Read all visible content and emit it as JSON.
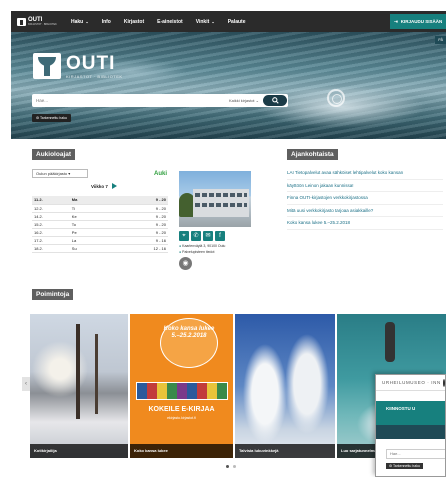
{
  "topbar": {
    "brand_name": "OUTI",
    "brand_sub": "KIRJASTOT · BIBLIOTEK",
    "nav": [
      {
        "label": "Haku",
        "has_dropdown": true
      },
      {
        "label": "Info",
        "has_dropdown": false
      },
      {
        "label": "Kirjastot",
        "has_dropdown": false
      },
      {
        "label": "E-aineistot",
        "has_dropdown": false
      },
      {
        "label": "Vinkit",
        "has_dropdown": true
      },
      {
        "label": "Palaute",
        "has_dropdown": false
      }
    ],
    "login_label": "KIRJAUDU SISÄÄN"
  },
  "hero": {
    "title": "OUTI",
    "subtitle": "KIRJASTOT · BIBLIOTEK",
    "lang_tag": "PÅ",
    "search_placeholder": "Hae...",
    "search_scope": "Kaikki kirjastot",
    "advanced_search": "Tarkennettu haku"
  },
  "hours": {
    "title": "Aukioloajat",
    "branch_select": "Oulun pääkirjasto",
    "status": "Auki",
    "week_label": "Viikko 7",
    "rows": [
      {
        "date": "11.2.",
        "day": "Ma",
        "time": "9 - 20",
        "today": true
      },
      {
        "date": "12.2.",
        "day": "Ti",
        "time": "9 - 20",
        "today": false
      },
      {
        "date": "14.2.",
        "day": "Ke",
        "time": "9 - 20",
        "today": false
      },
      {
        "date": "15.2.",
        "day": "To",
        "time": "9 - 20",
        "today": false
      },
      {
        "date": "16.2.",
        "day": "Pe",
        "time": "9 - 20",
        "today": false
      },
      {
        "date": "17.2.",
        "day": "La",
        "time": "9 - 16",
        "today": false
      },
      {
        "date": "18.2.",
        "day": "Su",
        "time": "12 - 16",
        "today": false
      }
    ],
    "address": "Kaarlenväylä 3, 90100 Oulu",
    "services_link": "Palvelupisteen tiedot"
  },
  "news": {
    "title": "Ajankohtaista",
    "items": [
      "LAI Tietopalvelut avaa sähköiset lehtipalvelut koko kansan",
      "käyttöön Leinon jakaan kunnissa!",
      "Finna OUTI-kirjastojen verkkokirjastossa",
      "Mitä uusi verkkokirjasto tarjoaa asiakkaille?",
      "Koko kansa lukee 5.–25.2.2018"
    ]
  },
  "picks": {
    "title": "Poimintoja",
    "cards": [
      {
        "caption": "Kotikirjailija"
      },
      {
        "caption": "Koko kansa lukee",
        "bubble": "Koko kansa lukee 5.–25.2.2018",
        "headline": "KOKEILE E-KIRJAA",
        "url": "ekirjasto.kirjastot.fi"
      },
      {
        "caption": "Talvisia lukuvinkkejä"
      },
      {
        "caption": "Luo sarjatunnelmaa"
      }
    ]
  },
  "popup": {
    "header": "URHEILUMUSEO · INN",
    "band_text": "KIINNOSTU U",
    "search_placeholder": "Hae...",
    "advanced_search": "Tarkennettu haku"
  }
}
